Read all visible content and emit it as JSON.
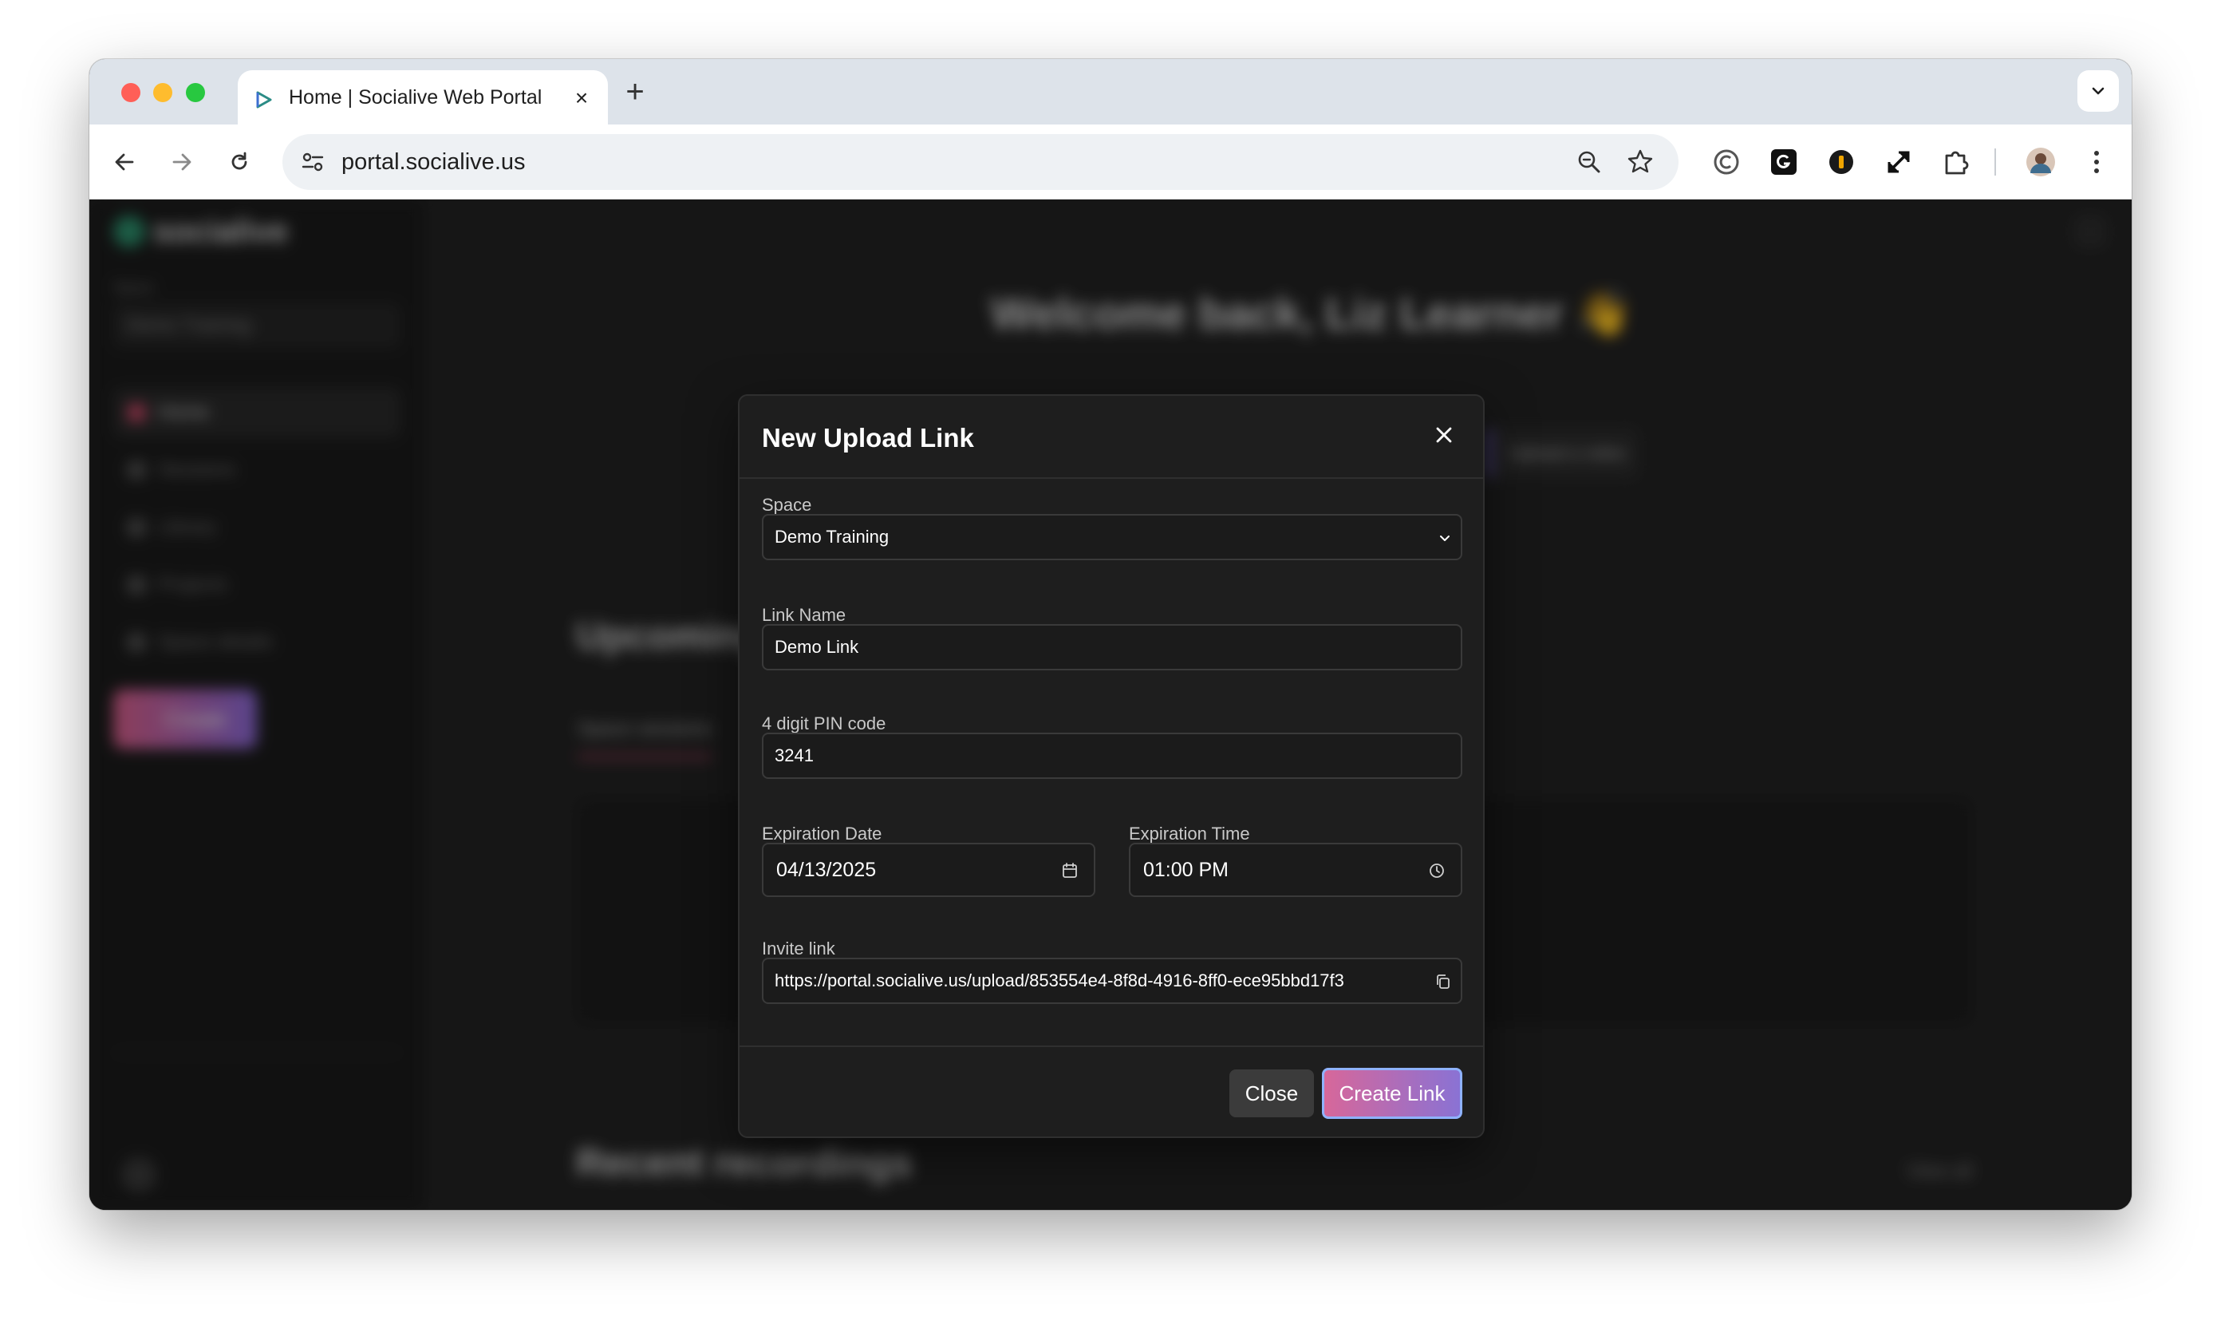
{
  "browser": {
    "tab_title": "Home | Socialive Web Portal",
    "url": "portal.socialive.us"
  },
  "background": {
    "logo_text": "socialive",
    "space_label": "Space",
    "space_value": "Demo Training",
    "nav": [
      "Home",
      "Sessions",
      "Library",
      "Projects",
      "Space details"
    ],
    "create_label": "Create",
    "welcome": "Welcome back, Liz Learner 👋",
    "upload_video": "Upload a video",
    "upcoming": "Upcoming",
    "upcoming_tab": "Space sessions",
    "recent": "Recent recordings",
    "view_all": "View all"
  },
  "modal": {
    "title": "New Upload Link",
    "space": {
      "label": "Space",
      "value": "Demo Training"
    },
    "link_name": {
      "label": "Link Name",
      "value": "Demo Link"
    },
    "pin": {
      "label": "4 digit PIN code",
      "value": "3241"
    },
    "expiration_date": {
      "label": "Expiration Date",
      "value": "04/13/2025"
    },
    "expiration_time": {
      "label": "Expiration Time",
      "value": "01:00 PM"
    },
    "invite_link": {
      "label": "Invite link",
      "value": "https://portal.socialive.us/upload/853554e4-8f8d-4916-8ff0-ece95bbd17f3"
    },
    "close_label": "Close",
    "create_label": "Create Link"
  },
  "colors": {
    "accent_start": "#d7679a",
    "accent_end": "#8a72d4",
    "modal_bg": "#1e1e1e"
  }
}
